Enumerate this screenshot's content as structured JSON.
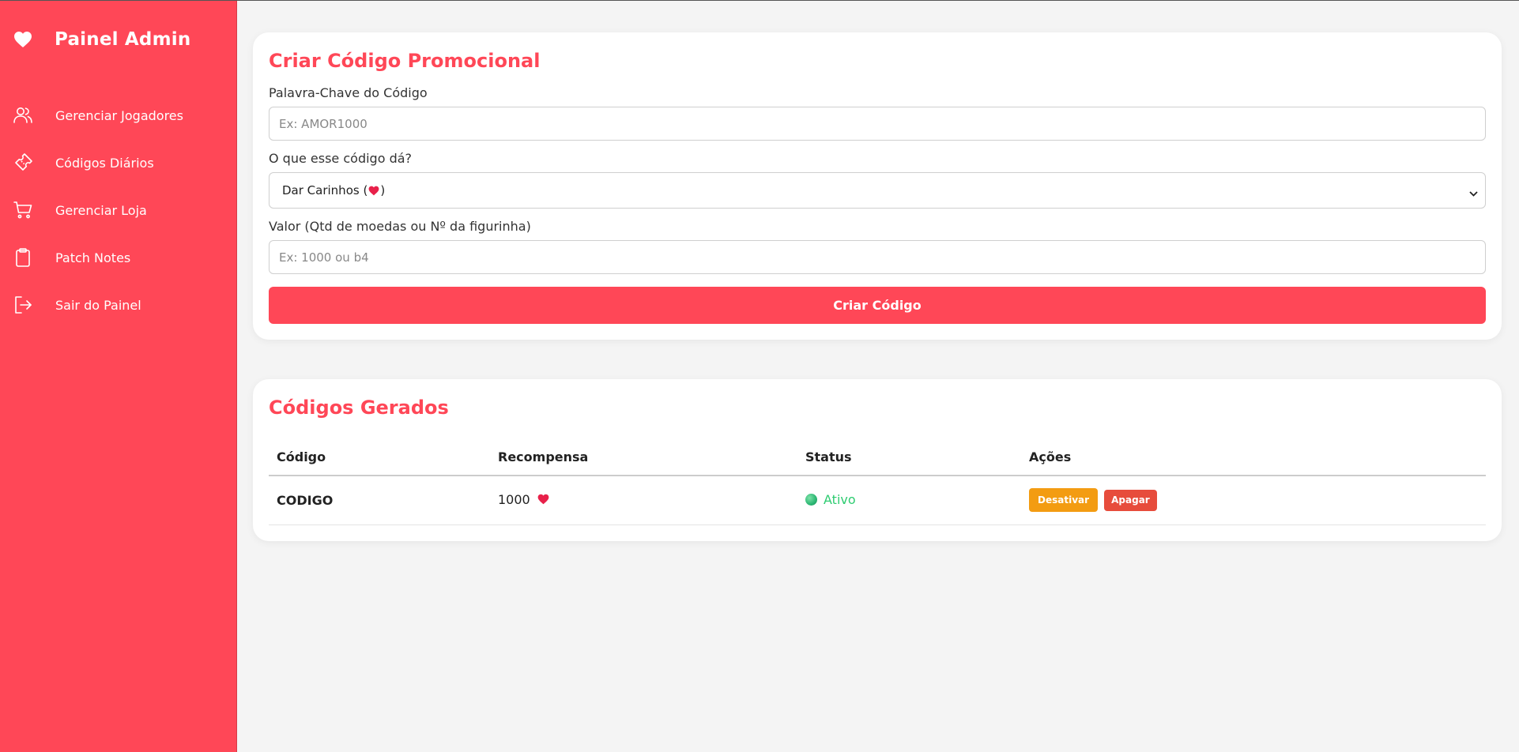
{
  "app": {
    "title": "Painel Admin",
    "brand_icon": "heart-icon"
  },
  "colors": {
    "accent": "#ff4757",
    "warn": "#f39c12",
    "danger": "#e74c3c",
    "success": "#2ecc71"
  },
  "sidebar": {
    "items": [
      {
        "label": "Gerenciar Jogadores",
        "icon": "users-icon"
      },
      {
        "label": "Códigos Diários",
        "icon": "ticket-icon"
      },
      {
        "label": "Gerenciar Loja",
        "icon": "cart-icon"
      },
      {
        "label": "Patch Notes",
        "icon": "clipboard-icon"
      },
      {
        "label": "Sair do Painel",
        "icon": "logout-icon"
      }
    ]
  },
  "create_form": {
    "title": "Criar Código Promocional",
    "keyword_label": "Palavra-Chave do Código",
    "keyword_placeholder": "Ex: AMOR1000",
    "keyword_value": "",
    "reward_type_label": "O que esse código dá?",
    "reward_type_selected_text": "Dar Carinhos (",
    "reward_type_selected_suffix": ")",
    "value_label": "Valor (Qtd de moedas ou Nº da figurinha)",
    "value_placeholder": "Ex: 1000 ou b4",
    "value_value": "",
    "submit_label": "Criar Código"
  },
  "codes": {
    "title": "Códigos Gerados",
    "columns": [
      "Código",
      "Recompensa",
      "Status",
      "Ações"
    ],
    "rows": [
      {
        "code": "CODIGO",
        "reward_amount": "1000",
        "status": "Ativo",
        "action_deactivate": "Desativar",
        "action_delete": "Apagar"
      }
    ]
  }
}
